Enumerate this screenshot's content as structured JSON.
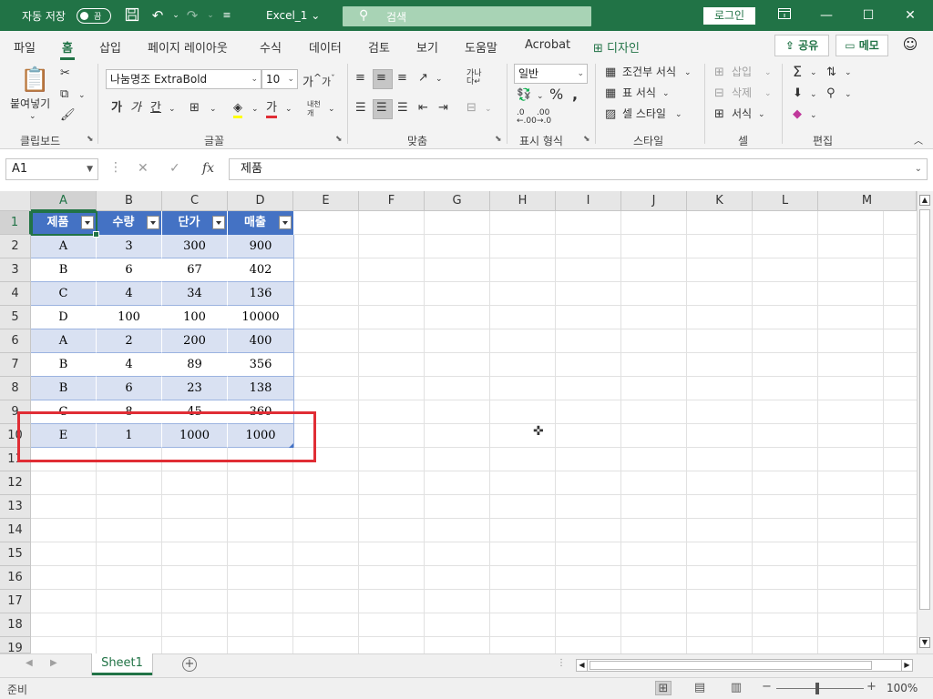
{
  "titlebar": {
    "autosave_label": "자동 저장",
    "autosave_toggle": "끔",
    "filename": "Excel_1 ⌄",
    "search_placeholder": "검색",
    "login_label": "로그인"
  },
  "ribbon_tabs": [
    "파일",
    "홈",
    "삽입",
    "페이지 레이아웃",
    "수식",
    "데이터",
    "검토",
    "보기",
    "도움말",
    "Acrobat",
    "디자인"
  ],
  "active_tab": "홈",
  "share_label": "공유",
  "memo_label": "메모",
  "ribbon": {
    "paste_label": "붙여넣기",
    "font_name": "나눔명조 ExtraBold",
    "font_size": "10",
    "number_format": "일반",
    "styles": {
      "conditional": "조건부 서식",
      "table": "표 서식",
      "cell": "셀 스타일"
    },
    "cells": {
      "insert": "삽입",
      "delete": "삭제",
      "format": "서식"
    },
    "group_labels": {
      "clipboard": "클립보드",
      "font": "글꼴",
      "alignment": "맞춤",
      "number": "표시 형식",
      "styles": "스타일",
      "cells": "셀",
      "editing": "편집"
    }
  },
  "formula_bar": {
    "name_box": "A1",
    "formula": "제품"
  },
  "columns": [
    "A",
    "B",
    "C",
    "D",
    "E",
    "F",
    "G",
    "H",
    "I",
    "J",
    "K",
    "L",
    "M"
  ],
  "rows": [
    "1",
    "2",
    "3",
    "4",
    "5",
    "6",
    "7",
    "8",
    "9",
    "10",
    "11",
    "12",
    "13",
    "14",
    "15",
    "16",
    "17",
    "18",
    "19"
  ],
  "table": {
    "headers": [
      "제품",
      "수량",
      "단가",
      "매출"
    ],
    "rows": [
      [
        "A",
        "3",
        "300",
        "900"
      ],
      [
        "B",
        "6",
        "67",
        "402"
      ],
      [
        "C",
        "4",
        "34",
        "136"
      ],
      [
        "D",
        "100",
        "100",
        "10000"
      ],
      [
        "A",
        "2",
        "200",
        "400"
      ],
      [
        "B",
        "4",
        "89",
        "356"
      ],
      [
        "B",
        "6",
        "23",
        "138"
      ],
      [
        "C",
        "8",
        "45",
        "360"
      ],
      [
        "E",
        "1",
        "1000",
        "1000"
      ]
    ],
    "colors": {
      "header": "#4472c4",
      "band": "#d9e1f2"
    }
  },
  "highlight_color": "#e02d35",
  "sheet_tab": "Sheet1",
  "status": {
    "ready": "준비",
    "zoom": "100%"
  }
}
